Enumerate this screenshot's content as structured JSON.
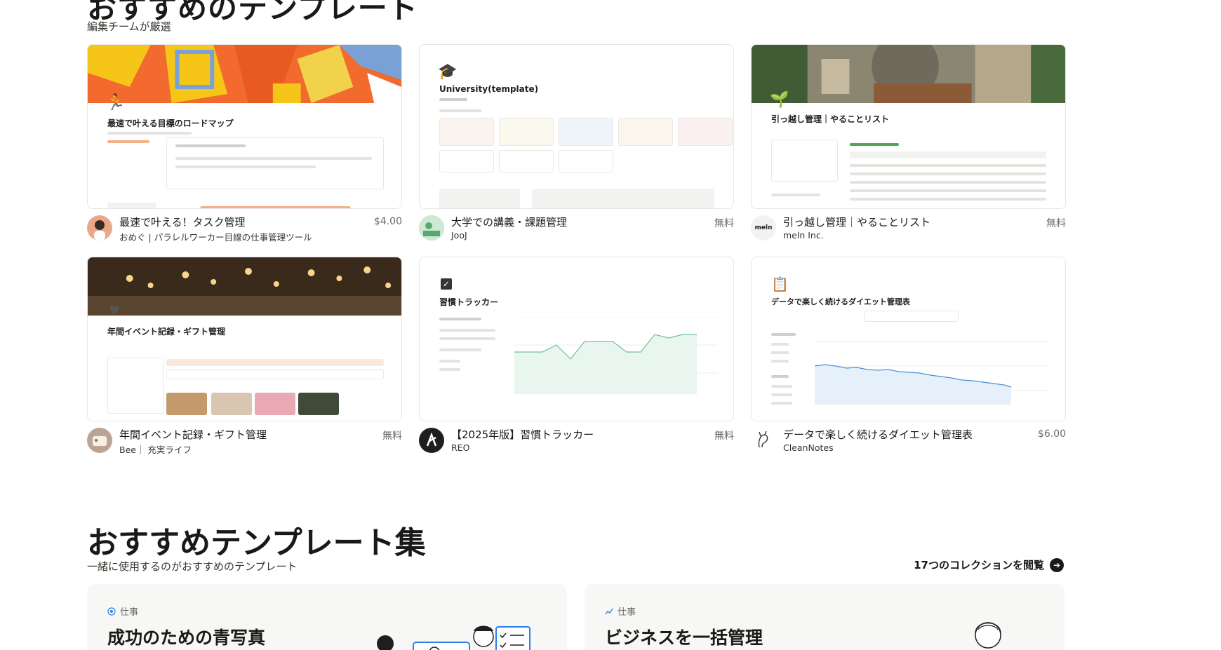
{
  "section": {
    "title": "おすすめのテンプレート",
    "subtitle": "編集チームが厳選"
  },
  "templates": [
    {
      "title": "最速で叶える！タスク管理",
      "author": "おめぐ | パラレルワーカー目線の仕事管理ツール",
      "price": "$4.00",
      "thumb_heading": "最速で叶える目標のロードマップ",
      "thumb_icon": "runner-icon"
    },
    {
      "title": "大学での講義・課題管理",
      "author": "JooJ",
      "price": "無料",
      "thumb_heading": "University(template)",
      "thumb_icon": "graduation-cap-icon"
    },
    {
      "title": "引っ越し管理｜やることリスト",
      "author": "meln Inc.",
      "price": "無料",
      "thumb_heading": "引っ越し管理｜やることリスト",
      "thumb_icon": "plant-icon",
      "avatar_text": "meln"
    },
    {
      "title": "年間イベント記録・ギフト管理",
      "author": "Bee｜ 充実ライフ",
      "price": "無料",
      "thumb_heading": "年間イベント記録・ギフト管理",
      "thumb_icon": "heart-icon"
    },
    {
      "title": "【2025年版】習慣トラッカー",
      "author": "REO",
      "price": "無料",
      "thumb_heading": "習慣トラッカー",
      "thumb_icon": "checkbox-icon"
    },
    {
      "title": "データで楽しく続けるダイエット管理表",
      "author": "CleanNotes",
      "price": "$6.00",
      "thumb_heading": "データで楽しく続けるダイエット管理表",
      "thumb_icon": "clipboard-icon"
    }
  ],
  "collections_section": {
    "title": "おすすめテンプレート集",
    "subtitle": "一緒に使用するのがおすすめのテンプレート",
    "link_label": "17つのコレクションを閲覧",
    "items": [
      {
        "tag": "仕事",
        "title": "成功のための青写真",
        "tag_icon": "target-icon"
      },
      {
        "tag": "仕事",
        "title": "ビジネスを一括管理",
        "tag_icon": "chart-icon"
      }
    ]
  },
  "colors": {
    "accent_blue": "#2f80ed",
    "banner_orange": "#f26a2e",
    "text": "#191918"
  }
}
